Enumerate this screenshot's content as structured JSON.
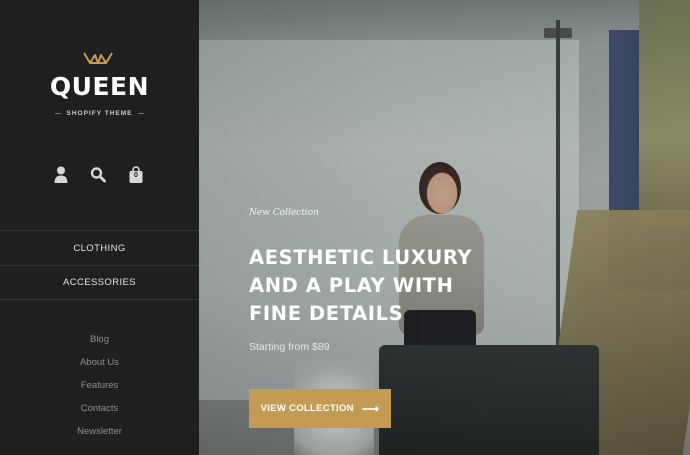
{
  "brand": {
    "name": "QUEEN",
    "tagline": "SHOPIFY THEME",
    "accent_color": "#c49b52"
  },
  "header_icons": {
    "account_icon": "user-icon",
    "search_icon": "search-icon",
    "cart_icon": "bag-icon",
    "cart_count": "0"
  },
  "nav": {
    "main": [
      {
        "label": "CLOTHING"
      },
      {
        "label": "ACCESSORIES"
      }
    ],
    "secondary": [
      {
        "label": "Blog"
      },
      {
        "label": "About Us"
      },
      {
        "label": "Features"
      },
      {
        "label": "Contacts"
      },
      {
        "label": "Newsletter"
      }
    ]
  },
  "hero": {
    "kicker": "New Collection",
    "headline_lines": [
      "AESTHETIC LUXURY",
      "AND A PLAY WITH",
      "FINE DETAILS"
    ],
    "price_text": "Starting from $89",
    "cta_label": "VIEW COLLECTION",
    "cta_icon": "arrow-right-icon"
  }
}
